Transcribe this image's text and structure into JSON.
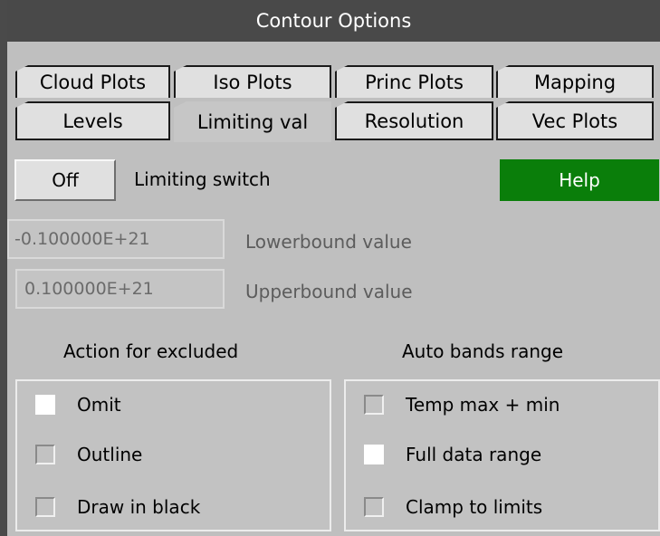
{
  "window": {
    "title": "Contour Options"
  },
  "tabs_row1": [
    {
      "label": "Cloud Plots"
    },
    {
      "label": "Iso Plots"
    },
    {
      "label": "Princ Plots"
    },
    {
      "label": "Mapping"
    }
  ],
  "tabs_row2": [
    {
      "label": "Levels"
    },
    {
      "label": "Limiting val",
      "active": true
    },
    {
      "label": "Resolution"
    },
    {
      "label": "Vec Plots"
    }
  ],
  "switch": {
    "button_label": "Off",
    "label": "Limiting switch"
  },
  "help": {
    "label": "Help",
    "color": "#0a7e0a"
  },
  "bounds": {
    "lower": {
      "value": "-0.100000E+21",
      "label": "Lowerbound value"
    },
    "upper": {
      "value": "0.100000E+21",
      "label": "Upperbound value"
    }
  },
  "excluded": {
    "heading": "Action for excluded",
    "options": [
      {
        "label": "Omit",
        "checked": true
      },
      {
        "label": "Outline",
        "checked": false
      },
      {
        "label": "Draw in black",
        "checked": false
      }
    ]
  },
  "auto_bands": {
    "heading": "Auto bands range",
    "options": [
      {
        "label": "Temp max + min",
        "checked": false
      },
      {
        "label": "Full data range",
        "checked": true
      },
      {
        "label": "Clamp to limits",
        "checked": false
      }
    ]
  }
}
